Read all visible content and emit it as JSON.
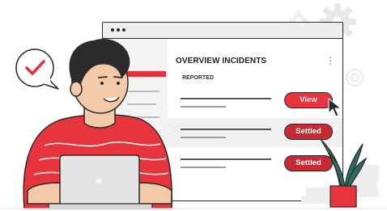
{
  "panel": {
    "title": "OVERVIEW INCIDENTS",
    "section_label": "REPORTED",
    "rows": [
      {
        "button_label": "View"
      },
      {
        "button_label": "Settled"
      },
      {
        "button_label": "Settled"
      }
    ]
  },
  "colors": {
    "accent": "#e8343d",
    "accent_dark": "#c62b34",
    "outline": "#2b2b2b",
    "gear": "#e6e6e6",
    "plant": "#2f6b5f"
  },
  "icons": [
    "checkmark-icon",
    "gear-icon",
    "cursor-icon",
    "laptop-icon"
  ]
}
